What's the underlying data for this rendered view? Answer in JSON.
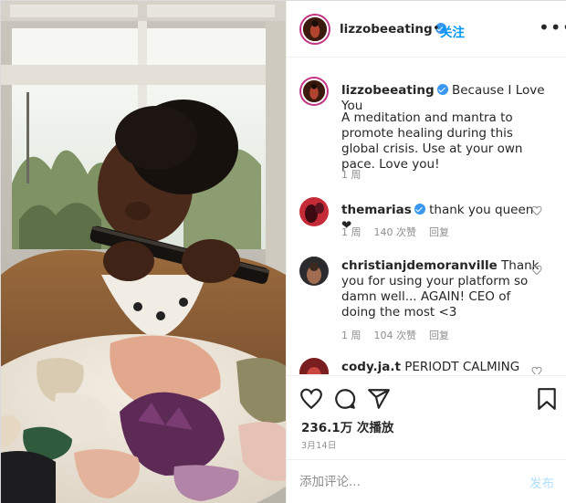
{
  "header": {
    "username": "lizzobeeating",
    "separator": "•",
    "follow_label": "关注",
    "more_label": "•••"
  },
  "caption": {
    "username": "lizzobeeating",
    "title": "Because I Love You",
    "body": "A meditation and mantra to promote healing during this global crisis. Use at your own pace. Love you!",
    "time": "1 周"
  },
  "comments": [
    {
      "username": "themarias",
      "text": "thank you queen ❤",
      "time": "1 周",
      "likes": "140 次赞",
      "reply": "回复"
    },
    {
      "username": "christianjdemoranville",
      "text": "Thank you for using your platform so damn well... AGAIN! CEO of doing the most <3",
      "time": "1 周",
      "likes": "104 次赞",
      "reply": "回复"
    },
    {
      "username": "cody.ja.t",
      "text": "PERIODT CALMING"
    }
  ],
  "actions": {
    "views": "236.1万 次播放",
    "date": "3月14日"
  },
  "comment_box": {
    "placeholder": "添加评论...",
    "post_label": "发布"
  },
  "colors": {
    "link_blue": "#0095f6",
    "post_disabled": "#b2dffc",
    "verified_blue": "#3897f0",
    "muted_gray": "#8e8e8e"
  },
  "icons": [
    "heart-icon",
    "comment-icon",
    "share-icon",
    "bookmark-icon",
    "verified-icon",
    "more-icon"
  ]
}
